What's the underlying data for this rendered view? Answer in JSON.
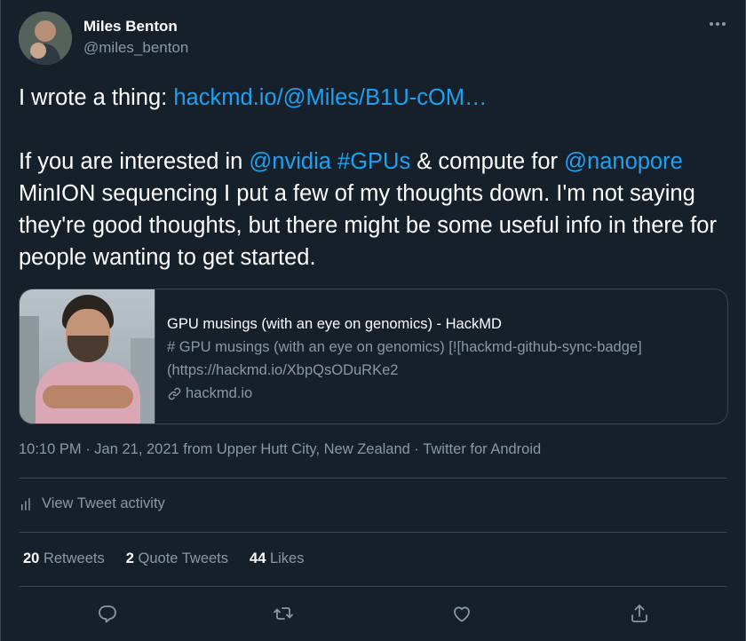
{
  "author": {
    "name": "Miles Benton",
    "handle": "@miles_benton"
  },
  "tweet": {
    "line1_prefix": "I wrote a thing: ",
    "line1_link": "hackmd.io/@Miles/B1U-cOM…",
    "p2_a": "If you are interested in ",
    "p2_mention1": "@nvidia",
    "p2_space": " ",
    "p2_hashtag": "#GPUs",
    "p2_b": " & compute for ",
    "p2_mention2": "@nanopore",
    "p2_c": " MinION sequencing I put a few of my thoughts down. I'm not saying they're good thoughts, but there might be some useful info in there for people wanting to get started."
  },
  "card": {
    "title": "GPU musings (with an eye on genomics) - HackMD",
    "description": "# GPU musings (with an eye on genomics) [![hackmd-github-sync-badge](https://hackmd.io/XbpQsODuRKe2",
    "domain": "hackmd.io"
  },
  "meta": {
    "time": "10:10 PM",
    "sep1": " · ",
    "date": "Jan 21, 2021",
    "from": " from ",
    "location": "Upper Hutt City, New Zealand",
    "sep2": " · ",
    "source": "Twitter for Android"
  },
  "activity": {
    "label": "View Tweet activity"
  },
  "stats": {
    "retweets_count": "20",
    "retweets_label": " Retweets",
    "quotes_count": "2",
    "quotes_label": " Quote Tweets",
    "likes_count": "44",
    "likes_label": " Likes"
  },
  "icons": {
    "more": "more-icon",
    "reply": "reply-icon",
    "retweet": "retweet-icon",
    "like": "heart-icon",
    "share": "share-icon",
    "link": "link-icon",
    "activity": "bar-chart-icon"
  },
  "colors": {
    "background": "#15202b",
    "text": "#ffffff",
    "secondary": "#8899a6",
    "link": "#1da1f2",
    "border": "#38444d"
  }
}
